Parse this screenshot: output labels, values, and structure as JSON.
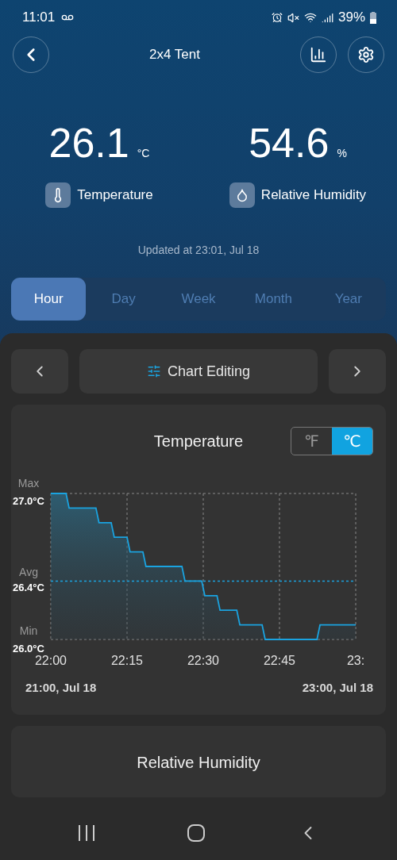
{
  "status_bar": {
    "time": "11:01",
    "battery": "39%"
  },
  "header": {
    "title": "2x4 Tent"
  },
  "readings": [
    {
      "kind": "temperature",
      "value": "26.1",
      "unit": "°C",
      "label": "Temperature"
    },
    {
      "kind": "humidity",
      "value": "54.6",
      "unit": "%",
      "label": "Relative Humidity"
    }
  ],
  "updated": "Updated at 23:01, Jul 18",
  "tabs": [
    {
      "label": "Hour",
      "selected": true
    },
    {
      "label": "Day",
      "selected": false
    },
    {
      "label": "Week",
      "selected": false
    },
    {
      "label": "Month",
      "selected": false
    },
    {
      "label": "Year",
      "selected": false
    }
  ],
  "chart_toolbar": {
    "label": "Chart Editing"
  },
  "charts": [
    {
      "title": "Temperature",
      "units": [
        {
          "label": "℉",
          "selected": false
        },
        {
          "label": "℃",
          "selected": true
        }
      ],
      "level_labels": [
        "Max",
        "Min"
      ],
      "chart_data": {
        "type": "area",
        "x": [
          22,
          22.05,
          22.06,
          22.148,
          22.158,
          22.198,
          22.208,
          22.25,
          22.26,
          22.302,
          22.312,
          22.43,
          22.44,
          22.495,
          22.505,
          22.545,
          22.555,
          22.61,
          22.62,
          22.693,
          22.703,
          22.873,
          22.883,
          23
        ],
        "series": [
          {
            "color": "#1aa3e0",
            "values": [
              27.0,
              27.0,
              26.9,
              26.9,
              26.8,
              26.8,
              26.7,
              26.7,
              26.6,
              26.6,
              26.5,
              26.5,
              26.4,
              26.4,
              26.3,
              26.3,
              26.2,
              26.2,
              26.1,
              26.1,
              26.0,
              26.0,
              26.1,
              26.1
            ]
          }
        ],
        "xlim": [
          22,
          23
        ],
        "ylim": [
          26.0,
          27.0
        ],
        "xticks": [
          {
            "value": 22,
            "label": "22:00"
          },
          {
            "value": 22.25,
            "label": "22:15"
          },
          {
            "value": 22.5,
            "label": "22:30"
          },
          {
            "value": 22.75,
            "label": "22:45"
          },
          {
            "value": 23,
            "label": "23:"
          }
        ],
        "yticks": [
          {
            "value": 27.0,
            "label": "27.0°C"
          },
          {
            "value": 26.4,
            "label": "26.4°C"
          },
          {
            "value": 26.0,
            "label": "26.0°C"
          }
        ],
        "grid": true,
        "ref_lines": [
          {
            "axis": "y",
            "value": 26.4,
            "label": "Avg",
            "color": "#1aa3e0"
          }
        ]
      },
      "range_start": "21:00, Jul 18",
      "range_end": "23:00, Jul 18"
    },
    {
      "title": "Relative Humidity"
    }
  ]
}
